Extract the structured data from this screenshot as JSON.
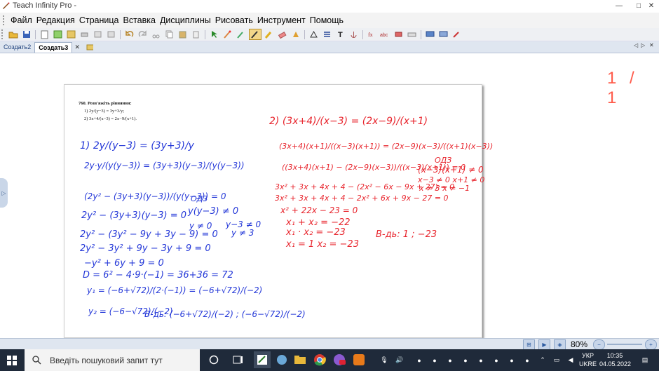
{
  "window": {
    "title": "Teach Infinity Pro -"
  },
  "menu": [
    "Файл",
    "Редакция",
    "Страница",
    "Вставка",
    "Дисциплины",
    "Рисовать",
    "Инструмент",
    "Помощь"
  ],
  "tabs": [
    {
      "label": "Создать2",
      "active": false
    },
    {
      "label": "Создать3",
      "active": true
    }
  ],
  "tab_nav": {
    "prev": "◁",
    "next": "▷",
    "close": "✕"
  },
  "page_counter": "1 / 1",
  "textbook": {
    "number": "760.",
    "prompt": "Розв'яжіть рівняння:",
    "item1": "1) 2y/(y−3) = 3y+3/y;",
    "item2": "2) 3x+4/(x−3) = 2x−9/(x+1)."
  },
  "zoom": "80%",
  "taskbar": {
    "search_placeholder": "Введіть пошуковий запит тут",
    "lang": "УКР",
    "lang2": "UKRE",
    "time": "10:35",
    "date": "04.05.2022"
  },
  "colors": {
    "ink_blue": "#2438d8",
    "ink_red": "#e8262e",
    "accent": "#2b5aa0"
  },
  "handwriting": {
    "left": [
      "1)  2y/(y−3) = (3y+3)/y",
      "2y·y/(y(y−3)) = (3y+3)(y−3)/(y(y−3))",
      "(2y² − (3y+3)(y−3))/(y(y−3)) = 0",
      "ОДЗ",
      "y(y−3) ≠ 0",
      "2y² − (3y+3)(y−3) = 0",
      "y ≠ 0",
      "y−3 ≠ 0",
      "y ≠ 3",
      "2y² − (3y² − 9y + 3y − 9) = 0",
      "2y² − 3y² + 9y − 3y + 9 = 0",
      "−y² + 6y + 9 = 0",
      "D = 6² − 4·9·(−1) = 36+36 = 72",
      "y₁ = (−6+√72)/(2·(−1)) = (−6+√72)/(−2)",
      "y₂ = (−6−√72)/(−2)",
      "В-дь: (−6+√72)/(−2) ; (−6−√72)/(−2)"
    ],
    "right": [
      "2)  (3x+4)/(x−3) = (2x−9)/(x+1)",
      "(3x+4)(x+1)/((x−3)(x+1)) = (2x−9)(x−3)/((x+1)(x−3))",
      "((3x+4)(x+1) − (2x−9)(x−3))/((x−3)(x+1)) = 0",
      "ОДЗ",
      "(x−3)(x+1) ≠ 0",
      "x−3 ≠ 0   x+1 ≠ 0",
      "x ≠ 3   x ≠ −1",
      "3x² + 3x + 4x + 4 − (2x² − 6x − 9x + 27) = 0",
      "3x² + 3x + 4x + 4 − 2x² + 6x + 9x − 27 = 0",
      "x² + 22x − 23 = 0",
      "x₁ + x₂ = −22",
      "x₁ · x₂ = −23",
      "x₁ = 1   x₂ = −23",
      "В-дь: 1 ; −23"
    ]
  }
}
